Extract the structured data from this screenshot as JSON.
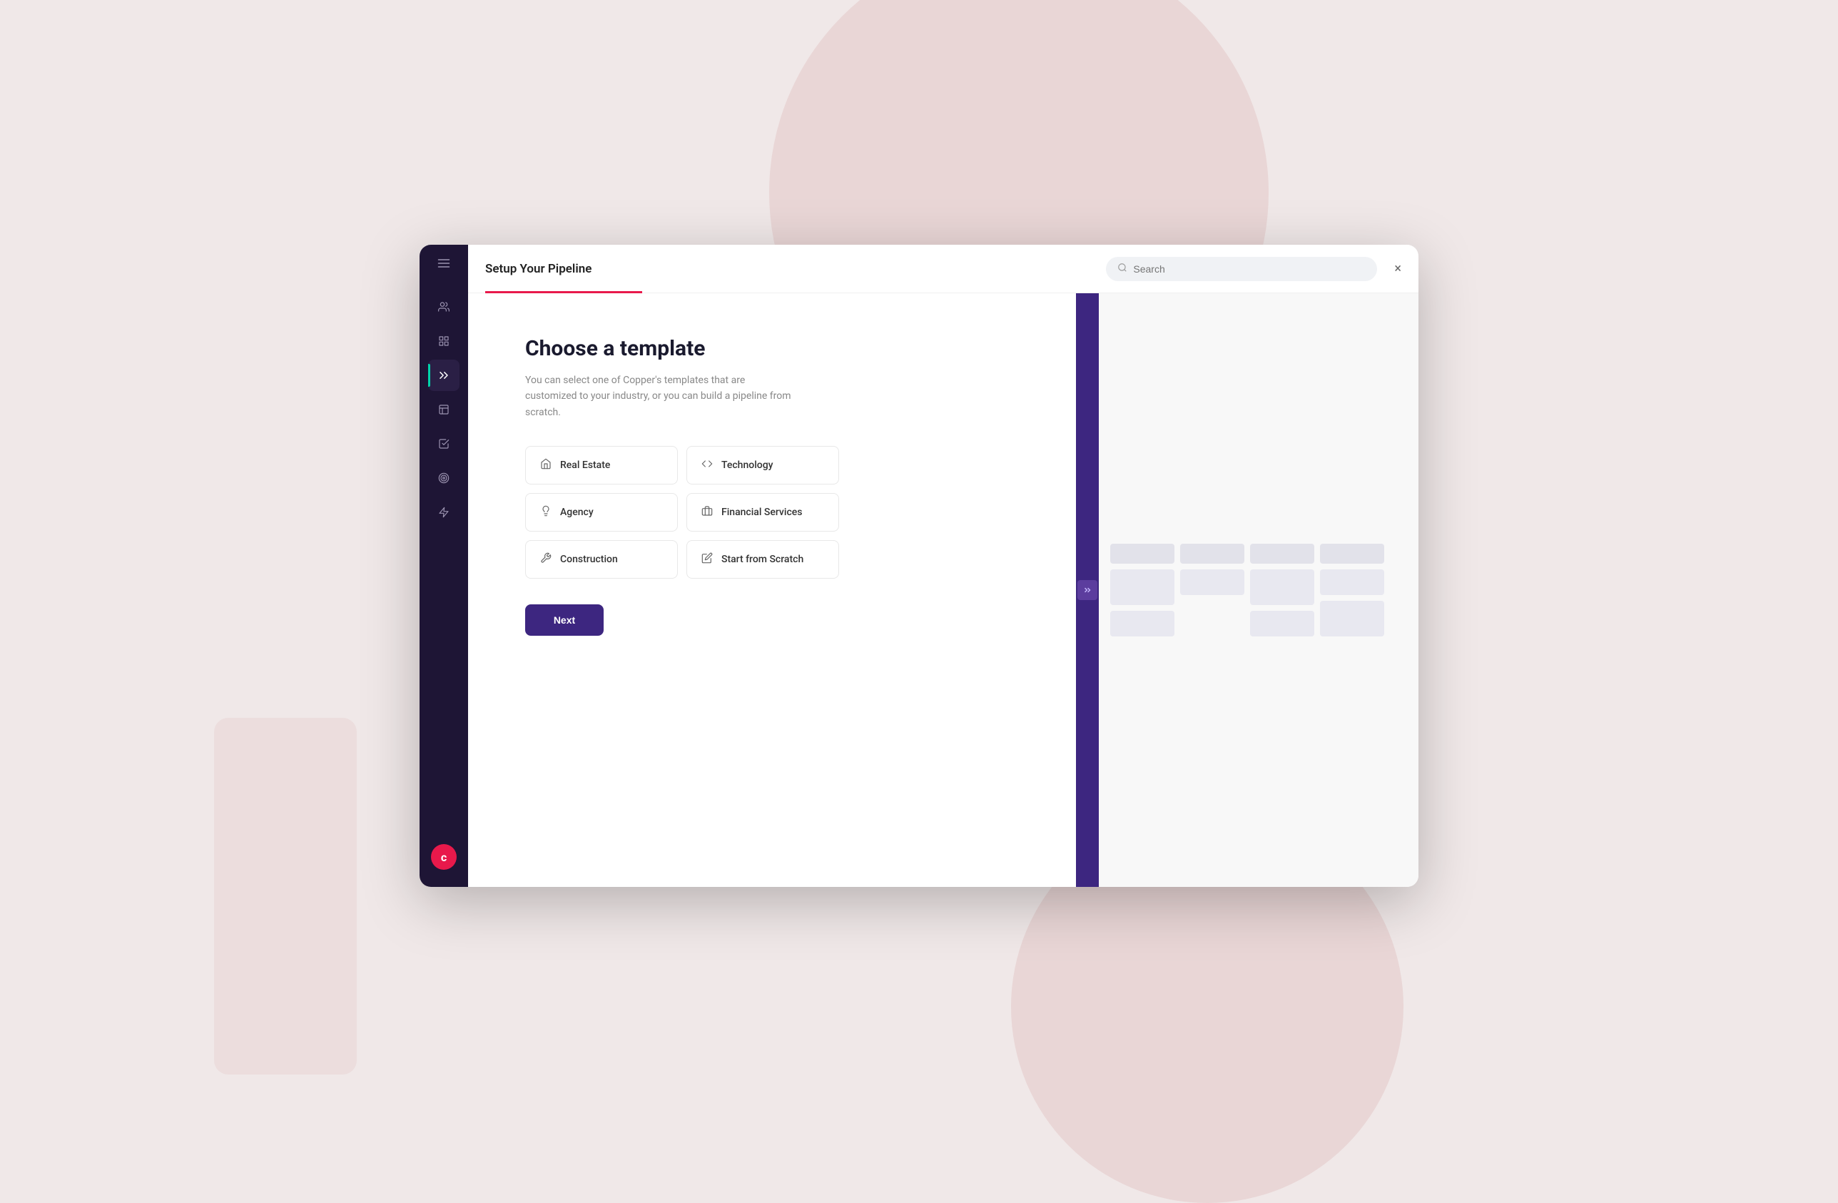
{
  "background": {
    "color": "#f0e8e8"
  },
  "header": {
    "title": "Setup Your Pipeline",
    "search_placeholder": "Search",
    "close_label": "×"
  },
  "sidebar": {
    "items": [
      {
        "id": "menu",
        "icon": "menu",
        "label": "Menu"
      },
      {
        "id": "contacts",
        "icon": "contacts",
        "label": "Contacts"
      },
      {
        "id": "dashboard",
        "icon": "dashboard",
        "label": "Dashboard"
      },
      {
        "id": "pipeline",
        "icon": "pipeline",
        "label": "Pipeline",
        "active": true
      },
      {
        "id": "reports",
        "icon": "reports",
        "label": "Reports"
      },
      {
        "id": "tasks",
        "icon": "tasks",
        "label": "Tasks"
      },
      {
        "id": "goals",
        "icon": "goals",
        "label": "Goals"
      },
      {
        "id": "automation",
        "icon": "automation",
        "label": "Automation"
      }
    ],
    "logo_letter": "c"
  },
  "main": {
    "title": "Choose a template",
    "description": "You can select one of Copper's templates that are customized to your industry, or you can build a pipeline from scratch.",
    "templates": [
      {
        "id": "real-estate",
        "label": "Real Estate",
        "icon": "home"
      },
      {
        "id": "technology",
        "label": "Technology",
        "icon": "code"
      },
      {
        "id": "agency",
        "label": "Agency",
        "icon": "lightbulb"
      },
      {
        "id": "financial-services",
        "label": "Financial Services",
        "icon": "briefcase"
      },
      {
        "id": "construction",
        "label": "Construction",
        "icon": "wrench"
      },
      {
        "id": "start-from-scratch",
        "label": "Start from Scratch",
        "icon": "edit"
      }
    ],
    "next_button": "Next"
  }
}
